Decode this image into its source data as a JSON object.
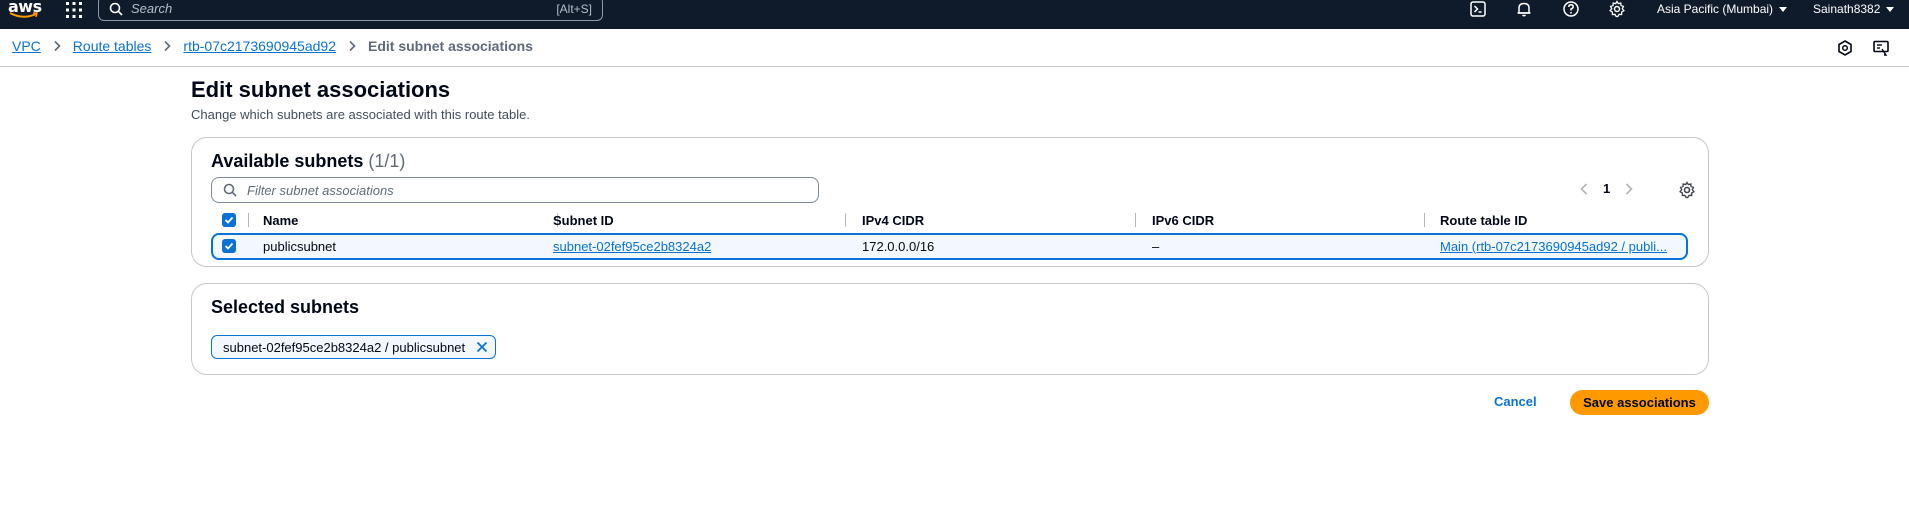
{
  "topnav": {
    "logo_text": "aws",
    "search_placeholder": "Search",
    "search_shortcut": "[Alt+S]",
    "region": "Asia Pacific (Mumbai)",
    "user": "Sainath8382"
  },
  "breadcrumb": {
    "items": [
      "VPC",
      "Route tables",
      "rtb-07c2173690945ad92"
    ],
    "current": "Edit subnet associations"
  },
  "page": {
    "title": "Edit subnet associations",
    "description": "Change which subnets are associated with this route table."
  },
  "available": {
    "title": "Available subnets",
    "count": "(1/1)",
    "filter_placeholder": "Filter subnet associations",
    "page_number": "1",
    "columns": [
      "Name",
      "Subnet ID",
      "IPv4 CIDR",
      "IPv6 CIDR",
      "Route table ID"
    ],
    "rows": [
      {
        "name": "publicsubnet",
        "subnet_id": "subnet-02fef95ce2b8324a2",
        "ipv4": "172.0.0.0/16",
        "ipv6": "–",
        "route_table": "Main (rtb-07c2173690945ad92 / publi..."
      }
    ]
  },
  "selected": {
    "title": "Selected subnets",
    "token": "subnet-02fef95ce2b8324a2 / publicsubnet"
  },
  "actions": {
    "cancel": "Cancel",
    "save": "Save associations"
  },
  "colors": {
    "nav_bg": "#0f1b2a",
    "link": "#0972d3",
    "primary": "#ff9900"
  }
}
